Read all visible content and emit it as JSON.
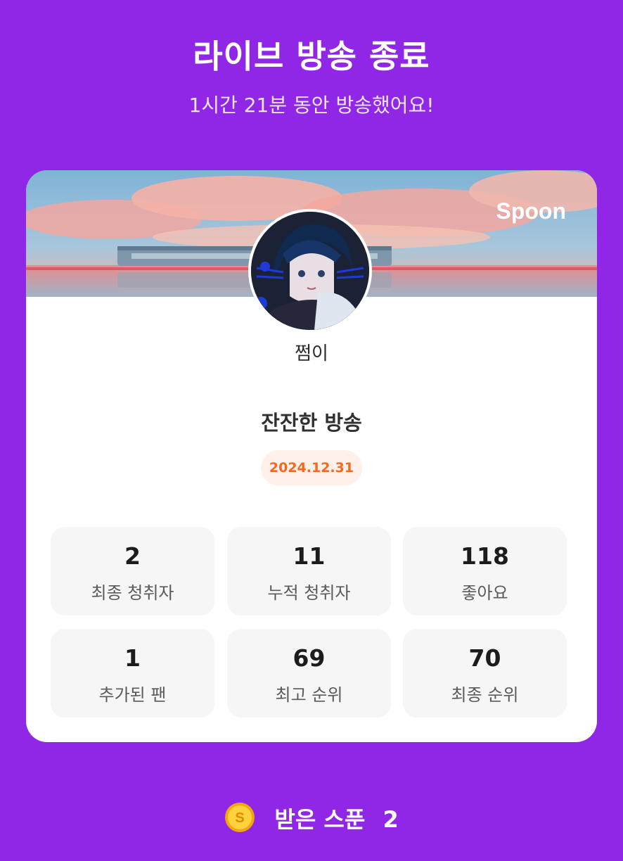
{
  "header": {
    "title": "라이브 방송 종료",
    "subtitle": "1시간 21분 동안 방송했어요!"
  },
  "card": {
    "brand": "Spoon",
    "username": "쩜이",
    "broadcast_title": "잔잔한 방송",
    "date": "2024.12.31",
    "stats": [
      {
        "value": "2",
        "label": "최종 청취자"
      },
      {
        "value": "11",
        "label": "누적 청취자"
      },
      {
        "value": "118",
        "label": "좋아요"
      },
      {
        "value": "1",
        "label": "추가된 팬"
      },
      {
        "value": "69",
        "label": "최고 순위"
      },
      {
        "value": "70",
        "label": "최종 순위"
      }
    ]
  },
  "footer": {
    "spoons_label": "받은 스푼",
    "spoons_value": "2"
  },
  "colors": {
    "background": "#9027e6",
    "date_text": "#f5681f",
    "date_badge": "#fff0ea"
  },
  "icons": {
    "coin": "spoon-coin-icon"
  }
}
